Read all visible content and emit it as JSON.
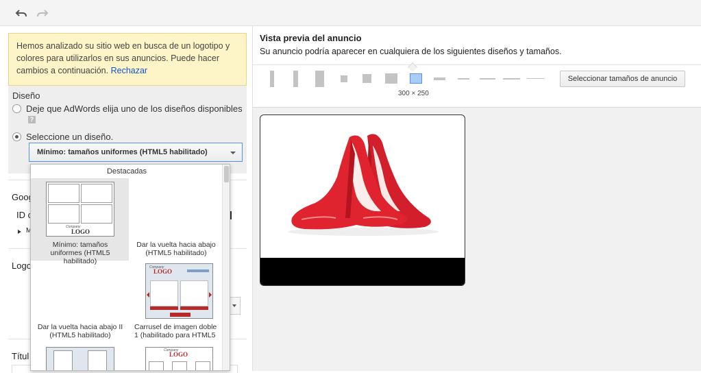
{
  "toolbar": {
    "undo_icon": "undo-icon",
    "redo_icon": "redo-icon"
  },
  "notice": {
    "text": "Hemos analizado su sitio web en busca de un logotipo y colores para utilizarlos en sus anuncios. Puede hacer cambios a continuación. ",
    "link": "Rechazar"
  },
  "design": {
    "title": "Diseño",
    "option_auto": "Deje que AdWords elija uno de los diseños disponibles",
    "help": "?",
    "option_manual": "Seleccione un diseño.",
    "selected": "Mínimo: tamaños uniformes (HTML5 habilitado)"
  },
  "background_labels": {
    "goog": "Goog",
    "id": "ID c",
    "m": "M",
    "logo": "Logo",
    "titu": "Títul"
  },
  "dropdown": {
    "header": "Destacadas",
    "tiles": [
      {
        "label": "Mínimo: tamaños uniformes (HTML5 habilitado)"
      },
      {
        "label": "Dar la vuelta hacia abajo (HTML5 habilitado)"
      },
      {
        "label": "Dar la vuelta hacia abajo II (HTML5 habilitado)"
      },
      {
        "label": "Carrusel de imagen doble 1 (habilitado para HTML5"
      }
    ],
    "logo_text": "LOGO",
    "company_text": "Company"
  },
  "preview": {
    "title": "Vista previa del anuncio",
    "subtitle": "Su anuncio podría aparecer en cualquiera de los siguientes diseños y tamaños.",
    "size_label": "300 × 250",
    "select_sizes_button": "Seleccionar tamaños de anuncio",
    "image": "red-high-heels-image"
  },
  "colors": {
    "accent": "#4d90fe",
    "notice_bg": "#fdf4c7",
    "selected_size": "#a9cdf5"
  }
}
